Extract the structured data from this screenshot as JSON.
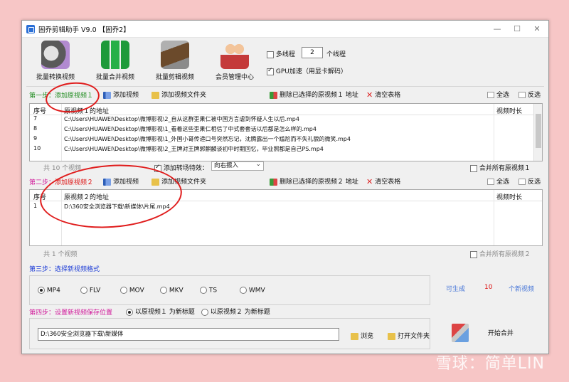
{
  "window": {
    "title": "固乔剪辑助手 V9.0 【固乔2】",
    "controls": [
      "—",
      "☐",
      "✕"
    ]
  },
  "toolbar": {
    "tools": [
      {
        "label": "批量转换视频",
        "icon": "film-reel-icon"
      },
      {
        "label": "批量合并视频",
        "icon": "film-strip-icon"
      },
      {
        "label": "批量剪辑视频",
        "icon": "scissors-film-icon"
      },
      {
        "label": "会员管理中心",
        "icon": "members-icon"
      }
    ],
    "multithread_label": "多线程",
    "thread_count": "2",
    "thread_unit": "个线程",
    "gpu_label": "GPU加速（用显卡解码）"
  },
  "step1": {
    "label": "第一步：",
    "add_original": "添加原视频１",
    "add_video": "添加视频",
    "add_folder": "添加视频文件夹",
    "delete_selected": "删除已选择的原视频１ 地址",
    "clear_table": "清空表格",
    "select_all": "全选",
    "invert": "反选",
    "columns": [
      "序号",
      "原视频１的地址",
      "视频时长"
    ],
    "rows": [
      {
        "no": "7",
        "path": "C:\\Users\\HUAWEI\\Desktop\\微博影视\\2_自从这群歪果仁被中国方言虐到怀疑人生以后.mp4"
      },
      {
        "no": "8",
        "path": "C:\\Users\\HUAWEI\\Desktop\\微博影视\\1_看着这些歪果仁相信了中式套套话以后都是怎么样的.mp4"
      },
      {
        "no": "9",
        "path": "C:\\Users\\HUAWEI\\Desktop\\微博影视\\1_外国小哥传递口号突然忘记，沈腾露出一个尴尬而不失礼貌的微笑.mp4"
      },
      {
        "no": "10",
        "path": "C:\\Users\\HUAWEI\\Desktop\\微博影视\\2_王牌对王牌郭麒麟谈初中时期回忆，毕业照都是自己PS.mp4"
      }
    ],
    "total": "共 10 个视频",
    "transition_label": "添加转场特效：",
    "transition_value": "向右擦入",
    "merge_all": "合并所有原视频１"
  },
  "step2": {
    "label": "第二步：",
    "add_original": "添加原视频２",
    "add_video": "添加视频",
    "add_folder": "添加视频文件夹",
    "delete_selected": "删除已选择的原视频２ 地址",
    "clear_table": "清空表格",
    "select_all": "全选",
    "invert": "反选",
    "columns": [
      "序号",
      "原视频２的地址",
      "视频时长"
    ],
    "rows": [
      {
        "no": "1",
        "path": "D:\\360安全浏览器下载\\新媒体\\片尾.mp4"
      }
    ],
    "total": "共 1 个视频",
    "merge_all": "合并所有原视频２"
  },
  "step3": {
    "label": "第三步：选择新视频格式",
    "formats": [
      "MP4",
      "FLV",
      "MOV",
      "MKV",
      "TS",
      "WMV"
    ],
    "selected_format": "MP4",
    "generate_prefix": "可生成",
    "generate_count": "10",
    "generate_suffix": "个新视频"
  },
  "step4": {
    "label": "第四步：设置新视频保存位置",
    "opt1": "以原视频１ 为新标题",
    "opt2": "以原视频２ 为新标题",
    "save_path": "D:\\360安全浏览器下载\\新媒体",
    "browse": "浏览",
    "open_folder": "打开文件夹",
    "start": "开始合并"
  },
  "watermark": "雪球：简单LIN",
  "colors": {
    "step_green": "#1c8a1c",
    "step_pink": "#d11a9a",
    "step_blue": "#1a3ad6",
    "annotation_red": "#e01d1d",
    "background": "#f7c6c6"
  }
}
